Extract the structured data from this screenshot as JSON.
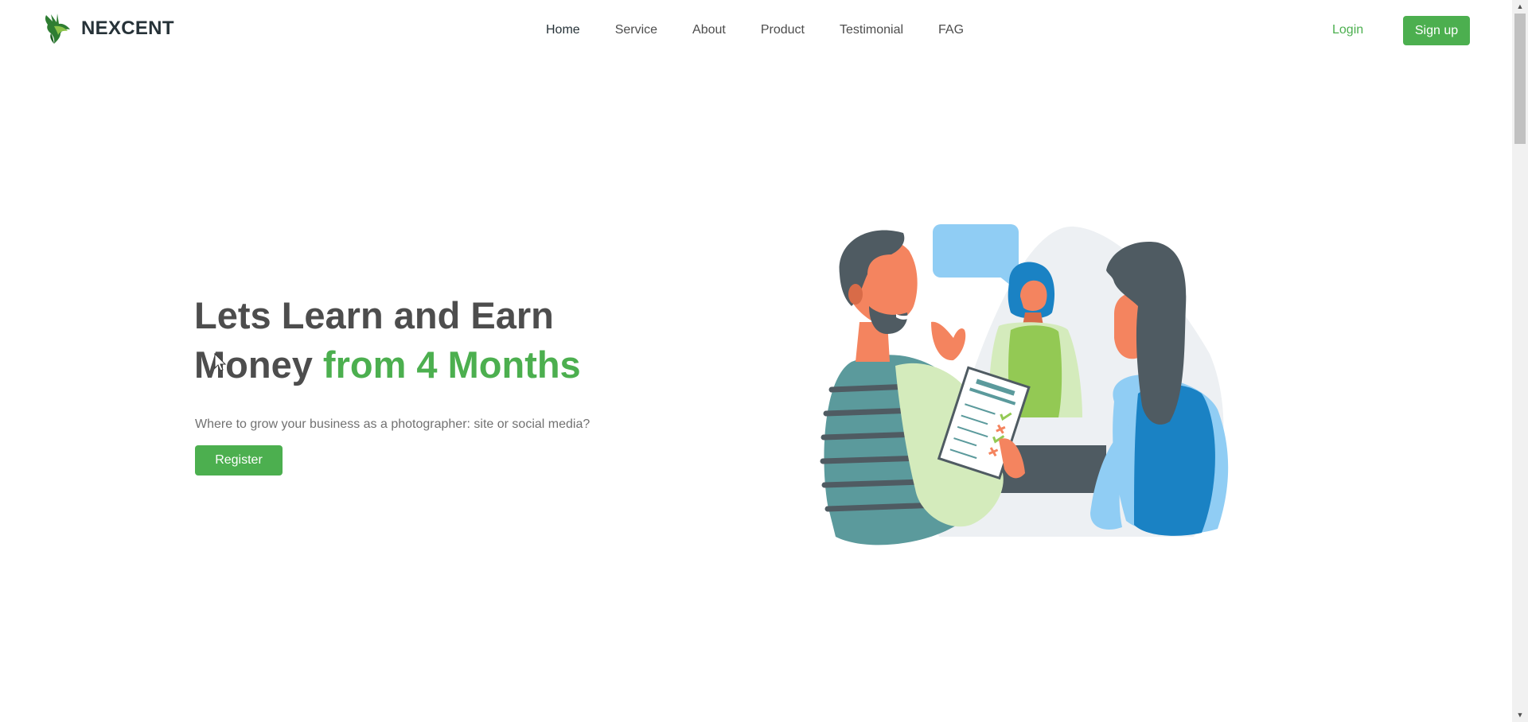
{
  "brand": {
    "name": "NEXCENT",
    "logo_icon": "leaf-bird-logo",
    "accent_color": "#4caf4f"
  },
  "nav": {
    "items": [
      {
        "label": "Home",
        "active": true
      },
      {
        "label": "Service",
        "active": false
      },
      {
        "label": "About",
        "active": false
      },
      {
        "label": "Product",
        "active": false
      },
      {
        "label": "Testimonial",
        "active": false
      },
      {
        "label": "FAG",
        "active": false
      }
    ]
  },
  "auth": {
    "login_label": "Login",
    "signup_label": "Sign up"
  },
  "hero": {
    "title_line1": "Lets Learn and Earn",
    "title_line2_plain": "Money",
    "title_line2_accent": "from 4 Months",
    "subtitle": "Where to grow your business as a photographer: site or social media?",
    "cta_label": "Register",
    "illustration": "team-meeting-illustration"
  }
}
